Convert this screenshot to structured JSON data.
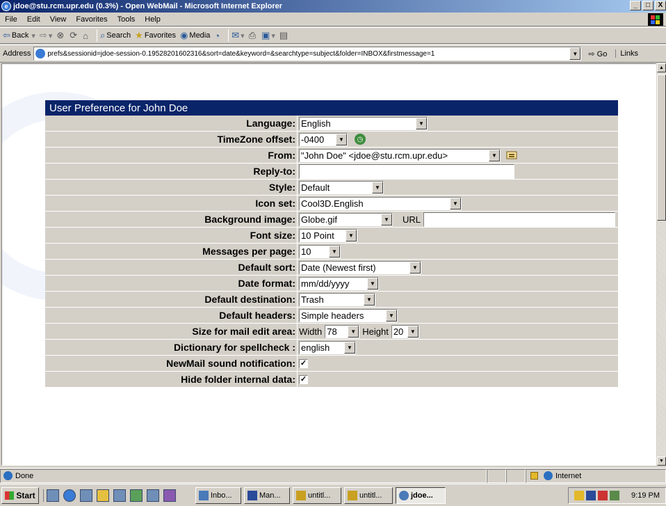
{
  "window": {
    "title": "jdoe@stu.rcm.upr.edu (0.3%) - Open WebMail - Microsoft Internet Explorer",
    "min": "_",
    "max": "□",
    "close": "X"
  },
  "menu": [
    "File",
    "Edit",
    "View",
    "Favorites",
    "Tools",
    "Help"
  ],
  "toolbar": {
    "back": "Back",
    "search": "Search",
    "favorites": "Favorites",
    "media": "Media"
  },
  "address": {
    "label": "Address",
    "url": "prefs&sessionid=jdoe-session-0.19528201602316&sort=date&keyword=&searchtype=subject&folder=INBOX&firstmessage=1",
    "go": "Go",
    "links": "Links"
  },
  "prefs": {
    "header": "User Preference for John Doe",
    "language": {
      "label": "Language:",
      "value": "English"
    },
    "timezone": {
      "label": "TimeZone offset:",
      "value": "-0400"
    },
    "from": {
      "label": "From:",
      "value": "\"John Doe\" <jdoe@stu.rcm.upr.edu>"
    },
    "replyto": {
      "label": "Reply-to:",
      "value": ""
    },
    "style": {
      "label": "Style:",
      "value": "Default"
    },
    "iconset": {
      "label": "Icon set:",
      "value": "Cool3D.English"
    },
    "bgimage": {
      "label": "Background image:",
      "value": "Globe.gif",
      "url_label": "URL"
    },
    "fontsize": {
      "label": "Font size:",
      "value": "10 Point"
    },
    "msgs": {
      "label": "Messages per page:",
      "value": "10"
    },
    "sort": {
      "label": "Default sort:",
      "value": "Date (Newest first)"
    },
    "dateformat": {
      "label": "Date format:",
      "value": "mm/dd/yyyy"
    },
    "dest": {
      "label": "Default destination:",
      "value": "Trash"
    },
    "headers": {
      "label": "Default headers:",
      "value": "Simple headers"
    },
    "editarea": {
      "label": "Size for mail edit area:",
      "width_label": "Width",
      "width": "78",
      "height_label": "Height",
      "height": "20"
    },
    "dict": {
      "label": "Dictionary for spellcheck :",
      "value": "english"
    },
    "sound": {
      "label": "NewMail sound notification:",
      "checked": "✓"
    },
    "hidefolder": {
      "label": "Hide folder internal data:",
      "checked": "✓"
    }
  },
  "status": {
    "text": "Done",
    "zone": "Internet"
  },
  "taskbar": {
    "start": "Start",
    "tasks": [
      "Inbo...",
      "Man...",
      "untitl...",
      "untitl...",
      "jdoe..."
    ],
    "clock": "9:19 PM"
  }
}
